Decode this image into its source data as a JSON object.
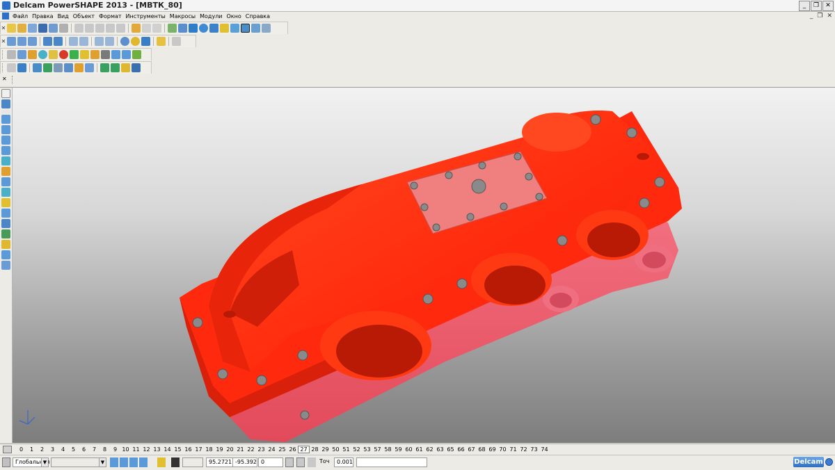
{
  "window": {
    "title": "Delcam PowerSHAPE 2013 - [МВТК_80]",
    "buttons": {
      "minimize": "_",
      "restore": "❐",
      "close": "✕"
    },
    "mdi_buttons": {
      "minimize": "_",
      "restore": "❐",
      "close": "✕"
    }
  },
  "menu": {
    "items": [
      "Файл",
      "Правка",
      "Вид",
      "Объект",
      "Формат",
      "Инструменты",
      "Макросы",
      "Модули",
      "Окно",
      "Справка"
    ]
  },
  "colors": {
    "part_red": "#ff2a0d",
    "part_shadow": "#c9200a",
    "part_pink": "#e8606e",
    "plate_pink": "#f08080",
    "bolt": "#8a8a8a"
  },
  "levels": {
    "items": [
      "0",
      "1",
      "2",
      "3",
      "4",
      "5",
      "6",
      "7",
      "8",
      "9",
      "10",
      "11",
      "12",
      "13",
      "14",
      "15",
      "16",
      "17",
      "18",
      "19",
      "20",
      "21",
      "22",
      "23",
      "24",
      "25",
      "26",
      "27",
      "28",
      "29",
      "50",
      "51",
      "52",
      "53",
      "57",
      "58",
      "59",
      "60",
      "61",
      "62",
      "63",
      "65",
      "66",
      "67",
      "68",
      "69",
      "70",
      "71",
      "72",
      "73",
      "74"
    ],
    "active": "27"
  },
  "status": {
    "workplane": "Глобальная",
    "x_value": "95.2721",
    "y_value": "-95.392",
    "z_value": "0",
    "tolerance_label": "Точ",
    "tolerance_value": "0.001",
    "brand": "Delcam"
  }
}
